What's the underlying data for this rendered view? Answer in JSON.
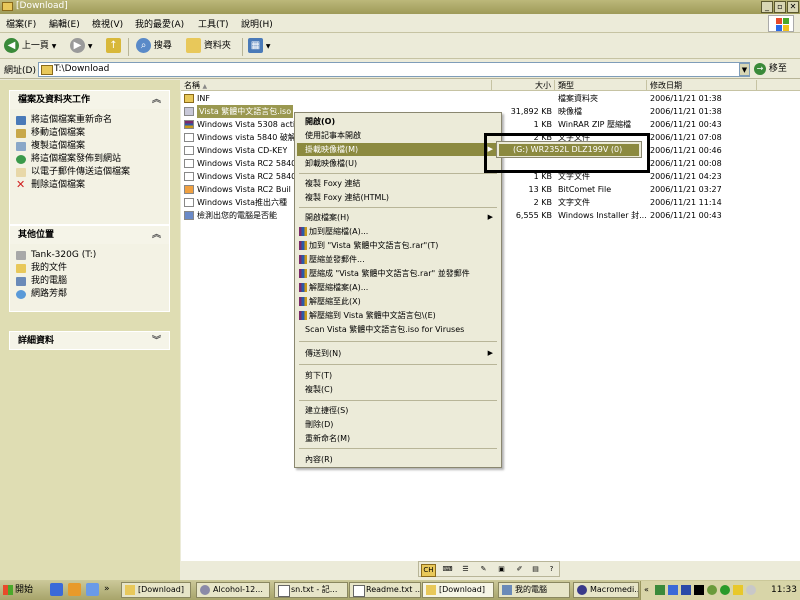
{
  "window": {
    "title": "[Download]"
  },
  "menubar": [
    "檔案(F)",
    "編輯(E)",
    "檢視(V)",
    "我的最愛(A)",
    "工具(T)",
    "說明(H)"
  ],
  "toolbar": {
    "back": "上一頁",
    "search": "搜尋",
    "folders": "資料夾"
  },
  "address": {
    "label": "網址(D)",
    "value": "T:\\Download",
    "go": "移至"
  },
  "left_panel": {
    "tasks_title": "檔案及資料夾工作",
    "tasks": [
      "將這個檔案重新命名",
      "移動這個檔案",
      "複製這個檔案",
      "將這個檔案發佈到網站",
      "以電子郵件傳送這個檔案",
      "刪除這個檔案"
    ],
    "places_title": "其他位置",
    "places": [
      "Tank-320G (T:)",
      "我的文件",
      "我的電腦",
      "網路芳鄰"
    ],
    "details_title": "詳細資料"
  },
  "columns": {
    "name": "名稱",
    "size": "大小",
    "type": "類型",
    "date": "修改日期"
  },
  "files": [
    {
      "name": "INF",
      "size": "",
      "type": "檔案資料夾",
      "date": "2006/11/21 01:38"
    },
    {
      "name": "Vista 繁體中文語言包.iso",
      "size": "31,892 KB",
      "type": "映像檔",
      "date": "2006/11/21 01:38"
    },
    {
      "name": "Windows Vista 5308 activ",
      "size": "1 KB",
      "type": "WinRAR ZIP 壓縮檔",
      "date": "2006/11/21 00:43"
    },
    {
      "name": "Windows vista 5840 破解",
      "size": "2 KB",
      "type": "文字文件",
      "date": "2006/11/21 07:08"
    },
    {
      "name": "Windows Vista CD-KEY",
      "size": "",
      "type": "",
      "date": "2006/11/21 00:46"
    },
    {
      "name": "Windows Vista RC2 5840",
      "size": "",
      "type": "",
      "date": "2006/11/21 00:08"
    },
    {
      "name": "Windows Vista RC2 5840",
      "size": "1 KB",
      "type": "文字文件",
      "date": "2006/11/21 04:23"
    },
    {
      "name": "Windows Vista RC2 Buil",
      "size": "13 KB",
      "type": "BitComet File",
      "date": "2006/11/21 03:27"
    },
    {
      "name": "Windows Vista推出六種",
      "size": "2 KB",
      "type": "文字文件",
      "date": "2006/11/21 11:14"
    },
    {
      "name": "檢測出您的電腦是否能",
      "size": "6,555 KB",
      "type": "Windows Installer 封...",
      "date": "2006/11/21 00:43"
    }
  ],
  "context_menu": [
    {
      "label": "開啟(O)",
      "bold": true
    },
    {
      "label": "使用記事本開啟"
    },
    {
      "label": "掛載映像檔(M)",
      "highlight": true,
      "submenu": true
    },
    {
      "label": "卸載映像檔(U)"
    },
    {
      "sep": true
    },
    {
      "label": "複製 Foxy 連結"
    },
    {
      "label": "複製 Foxy 連結(HTML)"
    },
    {
      "sep": true
    },
    {
      "label": "開啟檔案(H)",
      "submenu": true
    },
    {
      "label": "加到壓縮檔(A)...",
      "rar": true
    },
    {
      "label": "加到 \"Vista 繁體中文語言包.rar\"(T)",
      "rar": true
    },
    {
      "label": "壓縮並發郵件...",
      "rar": true
    },
    {
      "label": "壓縮成 \"Vista 繁體中文語言包.rar\" 並發郵件",
      "rar": true
    },
    {
      "label": "解壓縮檔案(A)...",
      "rar": true
    },
    {
      "label": "解壓縮至此(X)",
      "rar": true
    },
    {
      "label": "解壓縮到 Vista 繁體中文語言包\\(E)",
      "rar": true
    },
    {
      "label": "Scan Vista 繁體中文語言包.iso for Viruses"
    },
    {
      "sep": true
    },
    {
      "label": "傳送到(N)",
      "submenu": true
    },
    {
      "sep": true
    },
    {
      "label": "剪下(T)"
    },
    {
      "label": "複製(C)"
    },
    {
      "sep": true
    },
    {
      "label": "建立捷徑(S)"
    },
    {
      "label": "刪除(D)"
    },
    {
      "label": "重新命名(M)"
    },
    {
      "sep": true
    },
    {
      "label": "內容(R)"
    }
  ],
  "submenu": {
    "item": "(G:) WR2352L DLZ199V (0)"
  },
  "langbar": {
    "lang": "CH"
  },
  "taskbar": {
    "start": "開始",
    "buttons": [
      "[Download]",
      "Alcohol-12...",
      "sn.txt - 記...",
      "Readme.txt ...",
      "[Download]",
      "我的電腦",
      "Macromedi..."
    ],
    "clock": "11:33"
  },
  "colors": {
    "title": "#a7a365",
    "highlight": "#8c8a40",
    "annotation": "#000000"
  }
}
